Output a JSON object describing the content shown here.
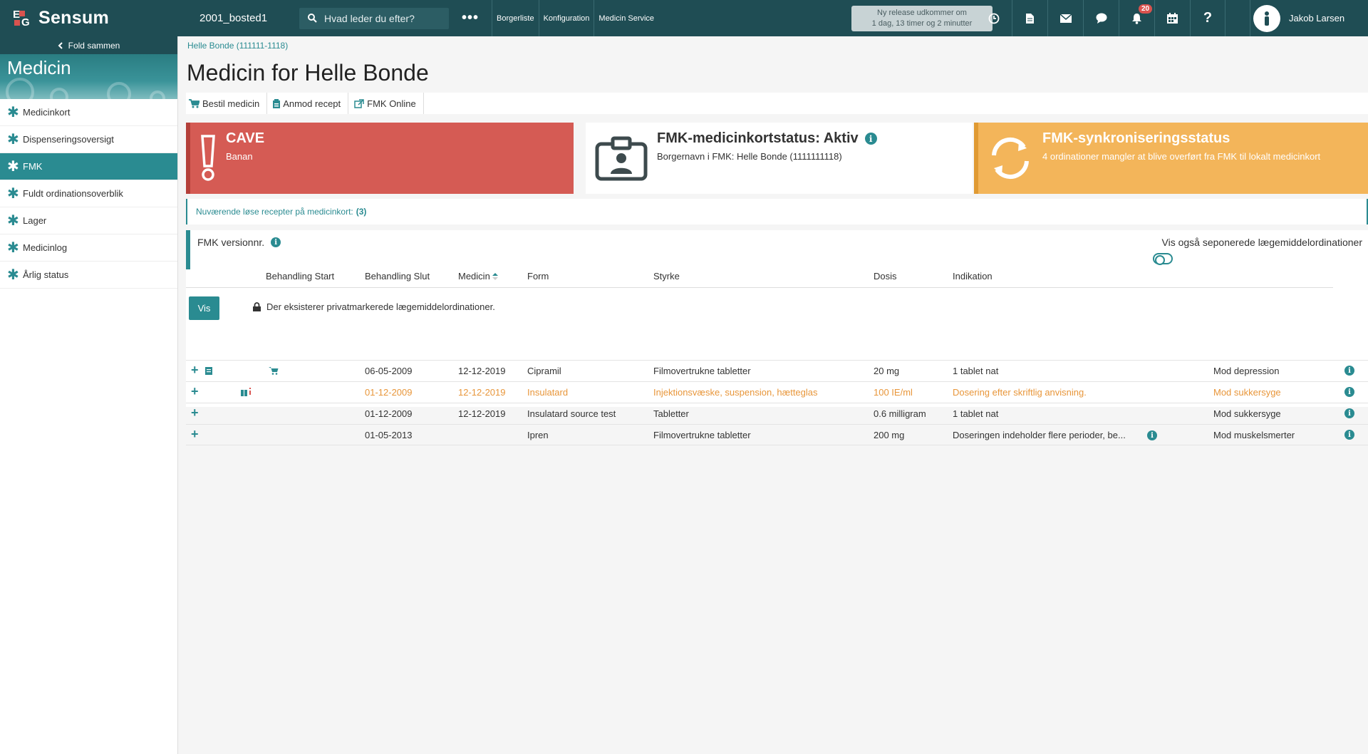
{
  "topbar": {
    "logo_text": "Sensum",
    "site_name": "2001_bosted1",
    "search_placeholder": "Hvad leder du efter?",
    "more": "•••",
    "nav": [
      "Borgerliste",
      "Konfiguration",
      "Medicin Service"
    ],
    "release_line1": "Ny release udkommer om",
    "release_line2": "1 dag, 13 timer og 2 minutter",
    "notification_count": "20",
    "user_name": "Jakob Larsen"
  },
  "sidebar": {
    "fold_label": "Fold sammen",
    "module_title": "Medicin",
    "items": [
      {
        "label": "Medicinkort",
        "active": false
      },
      {
        "label": "Dispenseringsoversigt",
        "active": false
      },
      {
        "label": "FMK",
        "active": true
      },
      {
        "label": "Fuldt ordinationsoverblik",
        "active": false
      },
      {
        "label": "Lager",
        "active": false
      },
      {
        "label": "Medicinlog",
        "active": false
      },
      {
        "label": "Årlig status",
        "active": false
      }
    ]
  },
  "main": {
    "breadcrumb": "Helle Bonde (111111-1118)",
    "title": "Medicin for Helle Bonde",
    "toolbar": {
      "order": "Bestil medicin",
      "request": "Anmod recept",
      "fmk_online": "FMK Online"
    },
    "cave": {
      "title": "CAVE",
      "sub": "Banan"
    },
    "fmk_status": {
      "title": "FMK-medicinkortstatus: Aktiv",
      "sub": "Borgernavn i FMK: Helle Bonde (1111111118)"
    },
    "sync_status": {
      "title": "FMK-synkroniseringsstatus",
      "sub": "4 ordinationer mangler at blive overført fra FMK til lokalt medicinkort"
    },
    "recipes_text": "Nuværende løse recepter på medicinkort:",
    "recipes_count": "(3)",
    "version_label": "FMK versionnr.",
    "toggle_label": "Vis også seponerede lægemiddelordinationer",
    "columns": {
      "start": "Behandling Start",
      "end": "Behandling Slut",
      "medicine": "Medicin",
      "form": "Form",
      "strength": "Styrke",
      "dose": "Dosis",
      "indication": "Indikation"
    },
    "vis_button": "Vis",
    "private_note": "Der eksisterer privatmarkerede lægemiddelordinationer.",
    "rows": [
      {
        "start": "",
        "end": "06-05-2009",
        "medicine": "12-12-2019",
        "form": "Cipramil",
        "strength": "Filmovertrukne tabletter",
        "dose": "20 mg",
        "dosis_text": "1 tablet nat",
        "indication": "Mod depression"
      },
      {
        "start": "01-12-2009",
        "end": "12-12-2019",
        "medicine": "Insulatard",
        "form": "Injektionsvæske, suspension, hætteglas",
        "strength": "100 IE/ml",
        "dose": "Dosering efter skriftlig anvisning.",
        "indication": "Mod sukkersyge"
      },
      {
        "start": "01-12-2009",
        "end": "12-12-2019",
        "medicine": "Insulatard source test",
        "form": "Tabletter",
        "strength": "0.6 milligram",
        "dose": "1 tablet nat",
        "indication": "Mod sukkersyge"
      },
      {
        "start": "01-05-2013",
        "end": "",
        "medicine": "Ipren",
        "form": "Filmovertrukne tabletter",
        "strength": "200 mg",
        "dose": "Doseringen indeholder flere perioder, be...",
        "indication": "Mod muskelsmerter"
      }
    ]
  },
  "colors": {
    "brand": "#1f4d54",
    "accent": "#2a8b91",
    "cave": "#d55b54",
    "sync": "#f3b55a",
    "warn_text": "#e8963a"
  }
}
